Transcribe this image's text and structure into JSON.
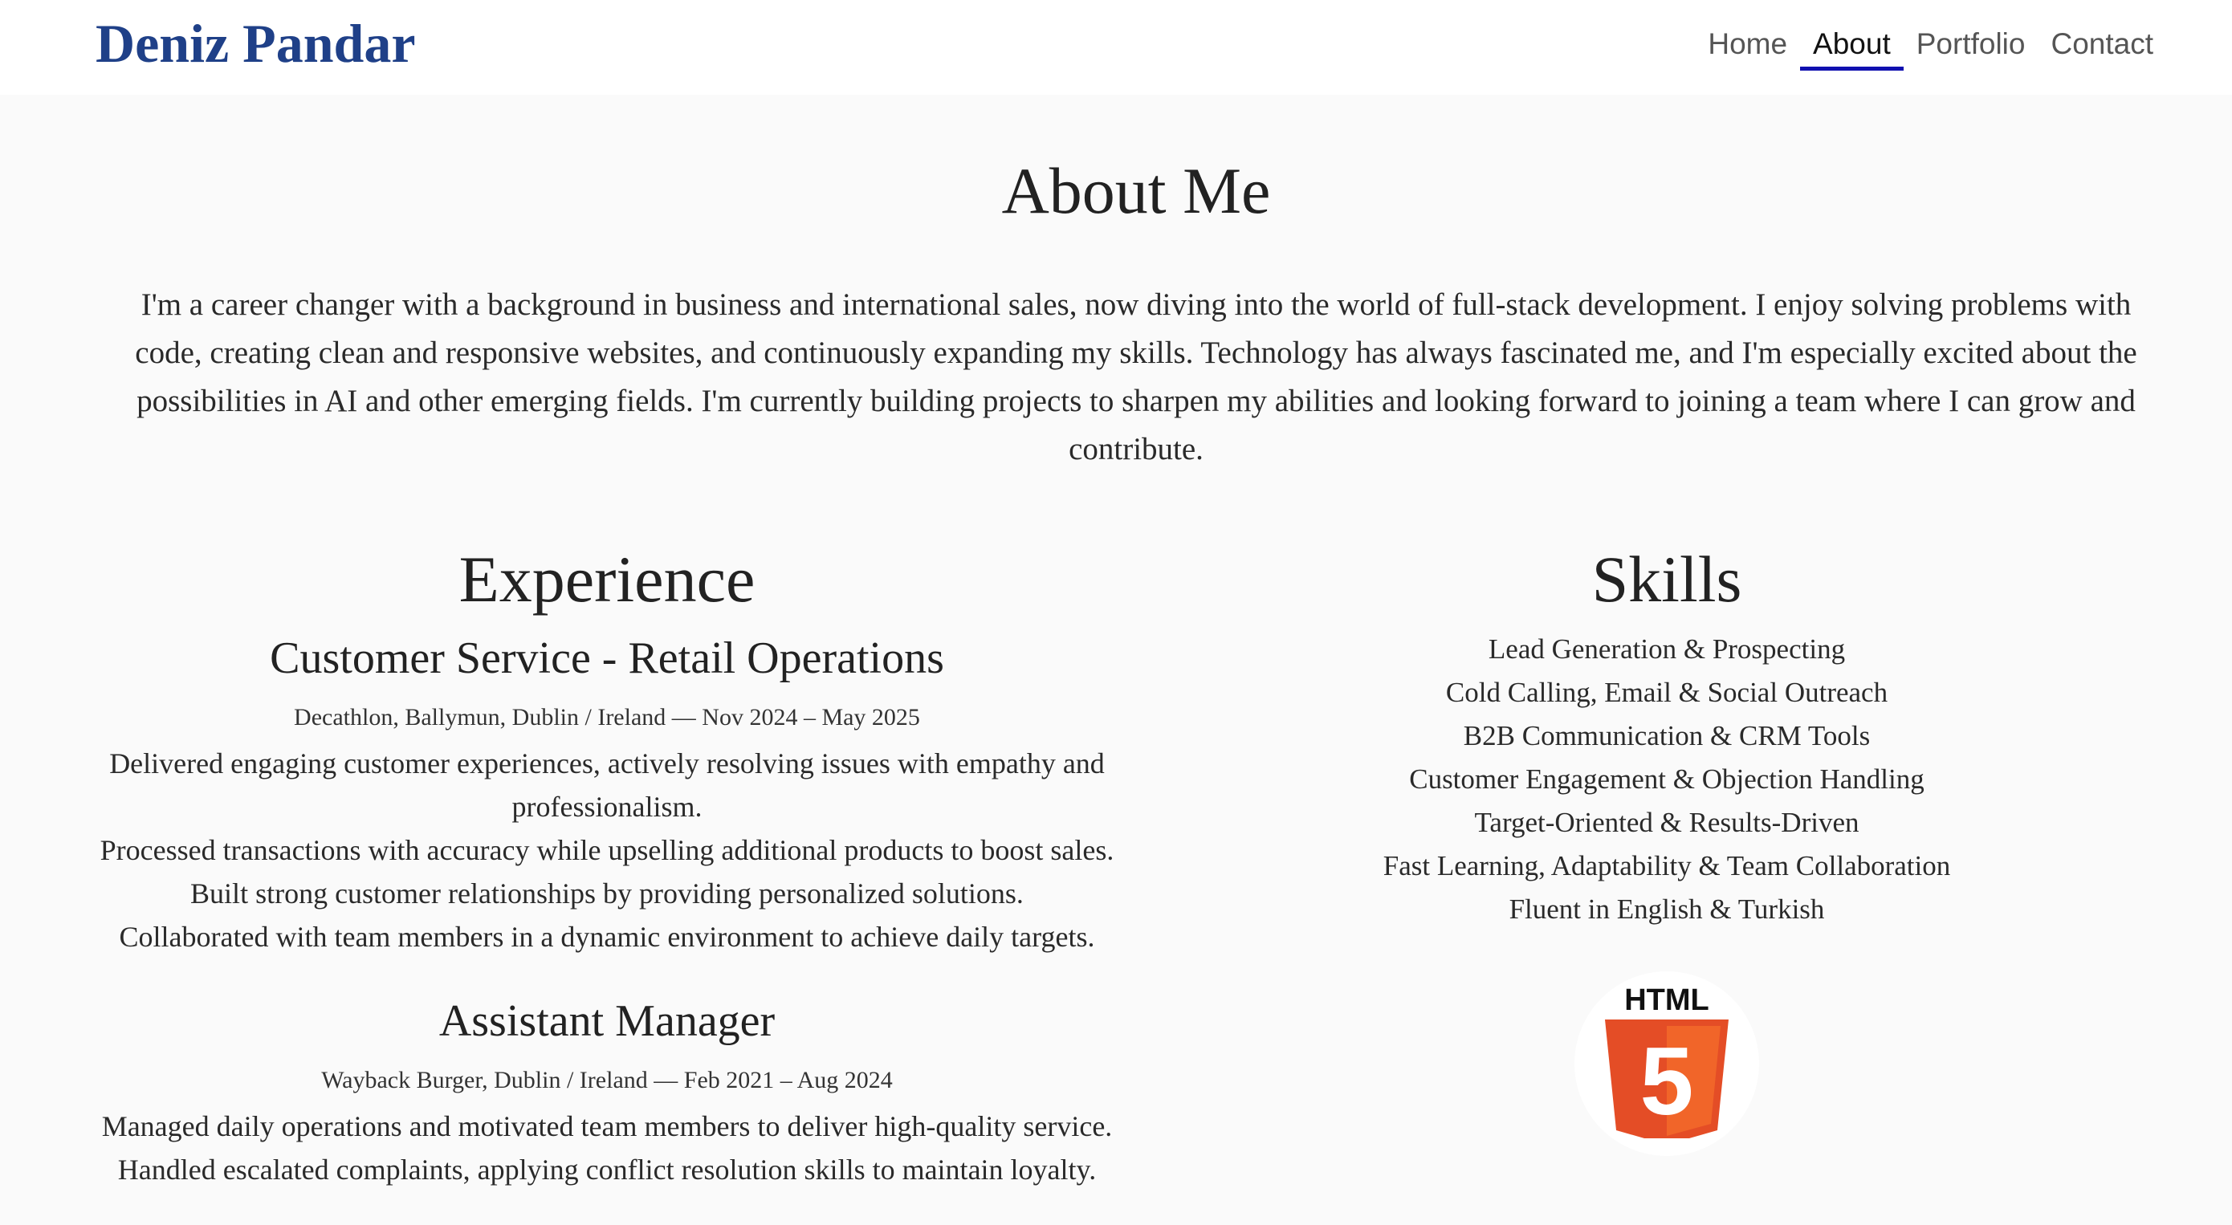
{
  "header": {
    "brand": "Deniz Pandar",
    "nav": [
      "Home",
      "About",
      "Portfolio",
      "Contact"
    ],
    "active": "About"
  },
  "about": {
    "title": "About Me",
    "text": "I'm a career changer with a background in business and international sales, now diving into the world of full-stack development. I enjoy solving problems with code, creating clean and responsive websites, and continuously expanding my skills. Technology has always fascinated me, and I'm especially excited about the possibilities in AI and other emerging fields. I'm currently building projects to sharpen my abilities and looking forward to joining a team where I can grow and contribute."
  },
  "experience": {
    "title": "Experience",
    "jobs": [
      {
        "title": "Customer Service - Retail Operations",
        "meta": "Decathlon, Ballymun, Dublin / Ireland — Nov 2024 – May 2025",
        "lines": [
          "Delivered engaging customer experiences, actively resolving issues with empathy and professionalism.",
          "Processed transactions with accuracy while upselling additional products to boost sales.",
          "Built strong customer relationships by providing personalized solutions.",
          "Collaborated with team members in a dynamic environment to achieve daily targets."
        ]
      },
      {
        "title": "Assistant Manager",
        "meta": "Wayback Burger, Dublin / Ireland — Feb 2021 – Aug 2024",
        "lines": [
          "Managed daily operations and motivated team members to deliver high-quality service.",
          "Handled escalated complaints, applying conflict resolution skills to maintain loyalty."
        ]
      }
    ]
  },
  "skills": {
    "title": "Skills",
    "items": [
      "Lead Generation & Prospecting",
      "Cold Calling, Email & Social Outreach",
      "B2B Communication & CRM Tools",
      "Customer Engagement & Objection Handling",
      "Target-Oriented & Results-Driven",
      "Fast Learning, Adaptability & Team Collaboration",
      "Fluent in English & Turkish"
    ],
    "logo": {
      "icon": "html5-logo-icon",
      "text": "HTML",
      "digit": "5",
      "color": "#e44d26",
      "shade": "#f16529"
    }
  }
}
